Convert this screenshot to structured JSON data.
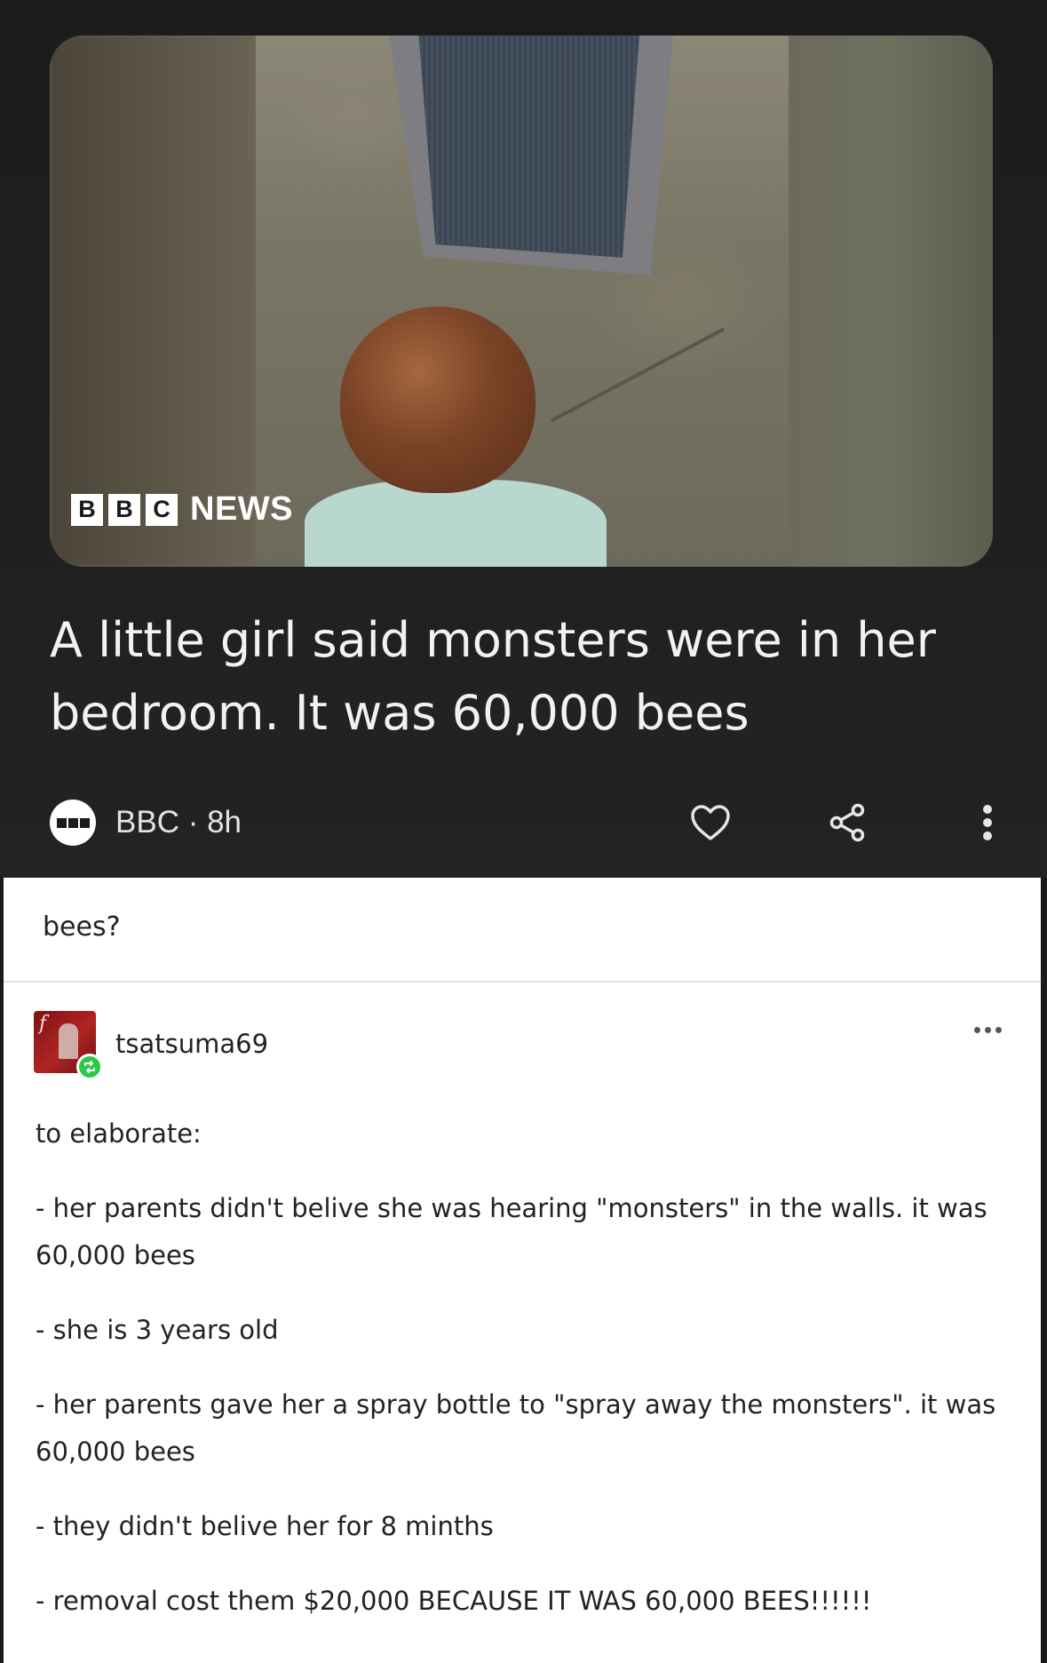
{
  "news_card": {
    "logo": {
      "letters": [
        "B",
        "B",
        "C"
      ],
      "word": "NEWS"
    },
    "headline": "A little girl said monsters were in her bedroom. It was 60,000 bees",
    "source": "BBC · 8h",
    "actions": [
      {
        "icon": "heart-icon"
      },
      {
        "icon": "share-icon"
      },
      {
        "icon": "more-vertical-icon"
      }
    ]
  },
  "post": {
    "reblog_comment": "bees?",
    "author": {
      "username": "tsatsuma69",
      "avatar_icon": "avatar",
      "badge_icon": "reblog-icon"
    },
    "menu_icon": "more-horizontal-icon",
    "paragraphs": [
      "to elaborate:",
      "- her parents didn't belive she was hearing \"monsters\" in the walls. it was 60,000 bees",
      "- she is 3 years old",
      "- her parents gave her a spray bottle to \"spray away the monsters\". it was 60,000 bees",
      "- they didn't belive her for 8 minths",
      "- removal cost them $20,000 BECAUSE IT WAS 60,000 BEES!!!!!!"
    ]
  },
  "colors": {
    "card_background": "#1c1c1c",
    "post_background": "#ffffff",
    "reblog_badge": "#2bc84a",
    "avatar": "#9e1b1b"
  }
}
